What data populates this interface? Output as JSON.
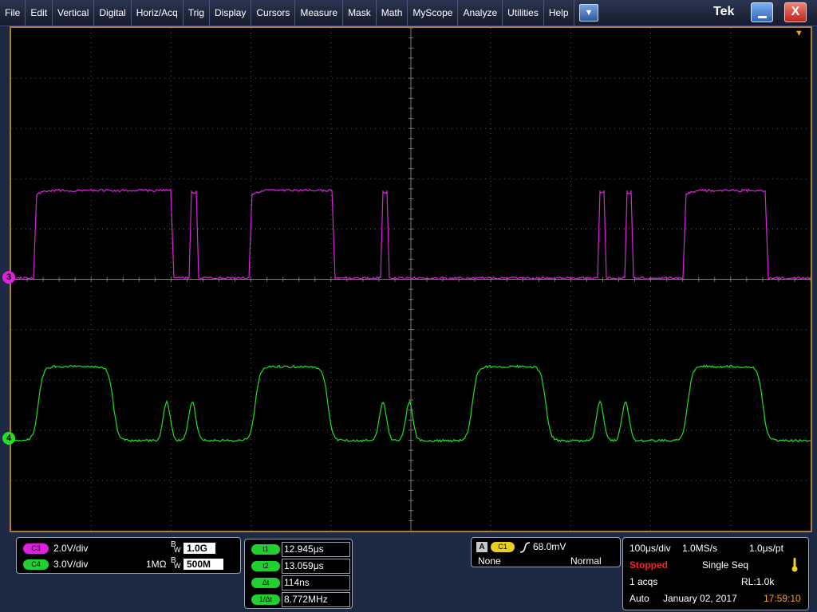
{
  "menu": [
    "File",
    "Edit",
    "Vertical",
    "Digital",
    "Horiz/Acq",
    "Trig",
    "Display",
    "Cursors",
    "Measure",
    "Mask",
    "Math",
    "MyScope",
    "Analyze",
    "Utilities",
    "Help"
  ],
  "window": {
    "dropdown_glyph": "▼",
    "brand": "Tek",
    "close_glyph": "X"
  },
  "markers": {
    "ch3": "3",
    "ch4": "4",
    "trigger_pos_glyph": "▼"
  },
  "colors": {
    "ch3": "#e020e0",
    "ch4": "#20e020",
    "graticule": "#5a5a5a",
    "frame": "#b07a38",
    "stopped": "#ff2020",
    "time": "#ffa020",
    "warn": "#f0d020"
  },
  "channels": {
    "c3": {
      "tag": "C3",
      "scale": "2.0V/div",
      "bw": "1.0G"
    },
    "c4": {
      "tag": "C4",
      "scale": "3.0V/div",
      "impedance": "1MΩ",
      "bw": "500M"
    }
  },
  "cursors": [
    {
      "label": "t1",
      "value": "12.945μs"
    },
    {
      "label": "t2",
      "value": "13.059μs"
    },
    {
      "label": "Δt",
      "value": "114ns"
    },
    {
      "label": "1/Δt",
      "value": "8.772MHz"
    }
  ],
  "trigger": {
    "tag_a": "A",
    "source": "C1",
    "level": "68.0mV",
    "coupling": "None",
    "mode": "Normal"
  },
  "acquisition": {
    "timebase": "100μs/div",
    "sample_rate": "1.0MS/s",
    "resolution": "1.0μs/pt",
    "state": "Stopped",
    "mode": "Single Seq",
    "acqs": "1 acqs",
    "record_length": "RL:1.0k",
    "run_mode": "Auto",
    "date": "January 02, 2017",
    "time": "17:59:10"
  }
}
